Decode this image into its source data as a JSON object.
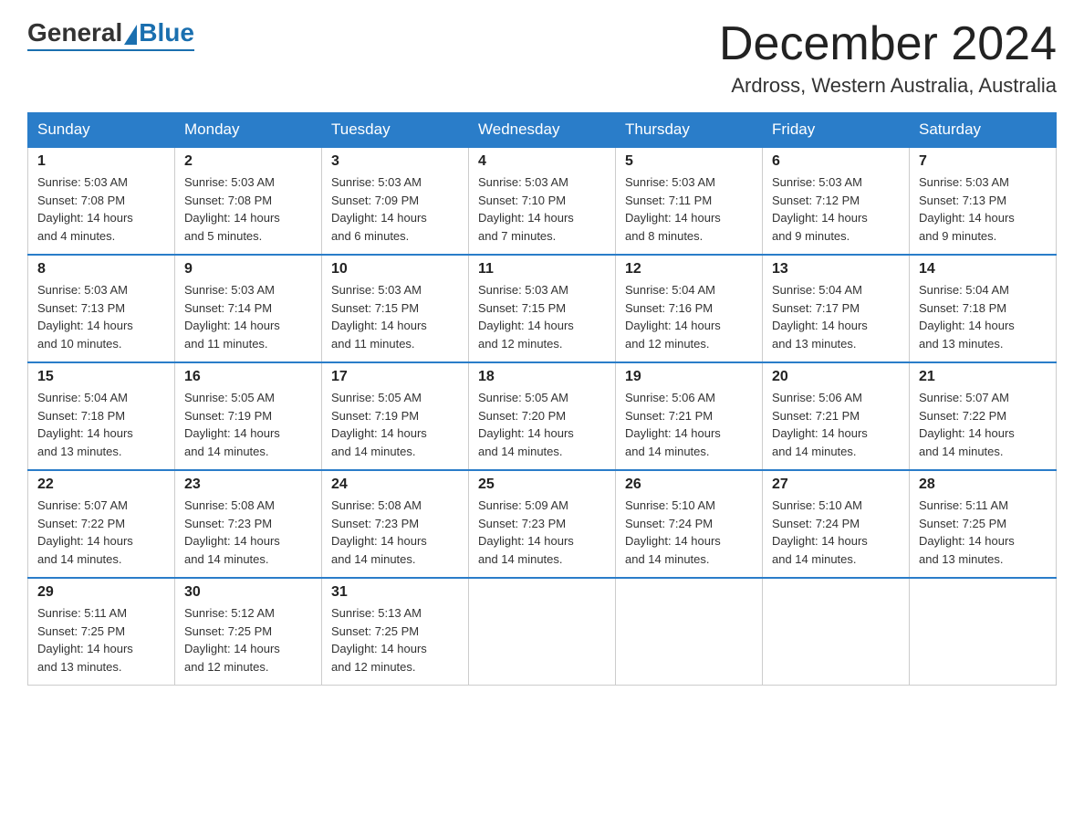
{
  "header": {
    "logo_general": "General",
    "logo_blue": "Blue",
    "main_title": "December 2024",
    "subtitle": "Ardross, Western Australia, Australia"
  },
  "days_of_week": [
    "Sunday",
    "Monday",
    "Tuesday",
    "Wednesday",
    "Thursday",
    "Friday",
    "Saturday"
  ],
  "weeks": [
    [
      {
        "day": "1",
        "sunrise": "5:03 AM",
        "sunset": "7:08 PM",
        "daylight": "14 hours and 4 minutes."
      },
      {
        "day": "2",
        "sunrise": "5:03 AM",
        "sunset": "7:08 PM",
        "daylight": "14 hours and 5 minutes."
      },
      {
        "day": "3",
        "sunrise": "5:03 AM",
        "sunset": "7:09 PM",
        "daylight": "14 hours and 6 minutes."
      },
      {
        "day": "4",
        "sunrise": "5:03 AM",
        "sunset": "7:10 PM",
        "daylight": "14 hours and 7 minutes."
      },
      {
        "day": "5",
        "sunrise": "5:03 AM",
        "sunset": "7:11 PM",
        "daylight": "14 hours and 8 minutes."
      },
      {
        "day": "6",
        "sunrise": "5:03 AM",
        "sunset": "7:12 PM",
        "daylight": "14 hours and 9 minutes."
      },
      {
        "day": "7",
        "sunrise": "5:03 AM",
        "sunset": "7:13 PM",
        "daylight": "14 hours and 9 minutes."
      }
    ],
    [
      {
        "day": "8",
        "sunrise": "5:03 AM",
        "sunset": "7:13 PM",
        "daylight": "14 hours and 10 minutes."
      },
      {
        "day": "9",
        "sunrise": "5:03 AM",
        "sunset": "7:14 PM",
        "daylight": "14 hours and 11 minutes."
      },
      {
        "day": "10",
        "sunrise": "5:03 AM",
        "sunset": "7:15 PM",
        "daylight": "14 hours and 11 minutes."
      },
      {
        "day": "11",
        "sunrise": "5:03 AM",
        "sunset": "7:15 PM",
        "daylight": "14 hours and 12 minutes."
      },
      {
        "day": "12",
        "sunrise": "5:04 AM",
        "sunset": "7:16 PM",
        "daylight": "14 hours and 12 minutes."
      },
      {
        "day": "13",
        "sunrise": "5:04 AM",
        "sunset": "7:17 PM",
        "daylight": "14 hours and 13 minutes."
      },
      {
        "day": "14",
        "sunrise": "5:04 AM",
        "sunset": "7:18 PM",
        "daylight": "14 hours and 13 minutes."
      }
    ],
    [
      {
        "day": "15",
        "sunrise": "5:04 AM",
        "sunset": "7:18 PM",
        "daylight": "14 hours and 13 minutes."
      },
      {
        "day": "16",
        "sunrise": "5:05 AM",
        "sunset": "7:19 PM",
        "daylight": "14 hours and 14 minutes."
      },
      {
        "day": "17",
        "sunrise": "5:05 AM",
        "sunset": "7:19 PM",
        "daylight": "14 hours and 14 minutes."
      },
      {
        "day": "18",
        "sunrise": "5:05 AM",
        "sunset": "7:20 PM",
        "daylight": "14 hours and 14 minutes."
      },
      {
        "day": "19",
        "sunrise": "5:06 AM",
        "sunset": "7:21 PM",
        "daylight": "14 hours and 14 minutes."
      },
      {
        "day": "20",
        "sunrise": "5:06 AM",
        "sunset": "7:21 PM",
        "daylight": "14 hours and 14 minutes."
      },
      {
        "day": "21",
        "sunrise": "5:07 AM",
        "sunset": "7:22 PM",
        "daylight": "14 hours and 14 minutes."
      }
    ],
    [
      {
        "day": "22",
        "sunrise": "5:07 AM",
        "sunset": "7:22 PM",
        "daylight": "14 hours and 14 minutes."
      },
      {
        "day": "23",
        "sunrise": "5:08 AM",
        "sunset": "7:23 PM",
        "daylight": "14 hours and 14 minutes."
      },
      {
        "day": "24",
        "sunrise": "5:08 AM",
        "sunset": "7:23 PM",
        "daylight": "14 hours and 14 minutes."
      },
      {
        "day": "25",
        "sunrise": "5:09 AM",
        "sunset": "7:23 PM",
        "daylight": "14 hours and 14 minutes."
      },
      {
        "day": "26",
        "sunrise": "5:10 AM",
        "sunset": "7:24 PM",
        "daylight": "14 hours and 14 minutes."
      },
      {
        "day": "27",
        "sunrise": "5:10 AM",
        "sunset": "7:24 PM",
        "daylight": "14 hours and 14 minutes."
      },
      {
        "day": "28",
        "sunrise": "5:11 AM",
        "sunset": "7:25 PM",
        "daylight": "14 hours and 13 minutes."
      }
    ],
    [
      {
        "day": "29",
        "sunrise": "5:11 AM",
        "sunset": "7:25 PM",
        "daylight": "14 hours and 13 minutes."
      },
      {
        "day": "30",
        "sunrise": "5:12 AM",
        "sunset": "7:25 PM",
        "daylight": "14 hours and 12 minutes."
      },
      {
        "day": "31",
        "sunrise": "5:13 AM",
        "sunset": "7:25 PM",
        "daylight": "14 hours and 12 minutes."
      },
      null,
      null,
      null,
      null
    ]
  ],
  "labels": {
    "sunrise": "Sunrise:",
    "sunset": "Sunset:",
    "daylight": "Daylight:"
  }
}
